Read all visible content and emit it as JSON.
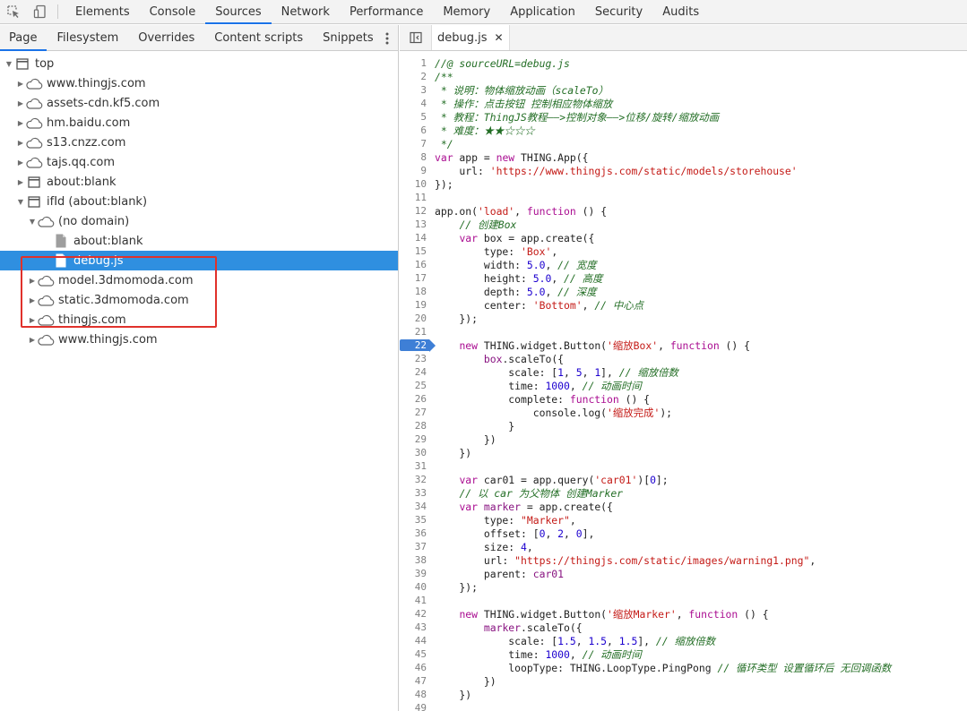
{
  "topbar": {
    "icons": [
      "inspect-element-icon",
      "device-toolbar-icon"
    ],
    "tabs": [
      "Elements",
      "Console",
      "Sources",
      "Network",
      "Performance",
      "Memory",
      "Application",
      "Security",
      "Audits"
    ],
    "active_tab": "Sources"
  },
  "navigator": {
    "tabs": [
      "Page",
      "Filesystem",
      "Overrides",
      "Content scripts",
      "Snippets"
    ],
    "active_tab": "Page",
    "more_icon": "more-vertical-icon",
    "tree": [
      {
        "label": "top",
        "icon": "frame-icon",
        "level": 0,
        "expanded": true
      },
      {
        "label": "www.thingjs.com",
        "icon": "cloud-icon",
        "level": 1,
        "expanded": false
      },
      {
        "label": "assets-cdn.kf5.com",
        "icon": "cloud-icon",
        "level": 1,
        "expanded": false
      },
      {
        "label": "hm.baidu.com",
        "icon": "cloud-icon",
        "level": 1,
        "expanded": false
      },
      {
        "label": "s13.cnzz.com",
        "icon": "cloud-icon",
        "level": 1,
        "expanded": false
      },
      {
        "label": "tajs.qq.com",
        "icon": "cloud-icon",
        "level": 1,
        "expanded": false
      },
      {
        "label": "about:blank",
        "icon": "frame-icon",
        "level": 1,
        "expanded": false
      },
      {
        "label": "ifId (about:blank)",
        "icon": "frame-icon",
        "level": 1,
        "expanded": true
      },
      {
        "label": "(no domain)",
        "icon": "cloud-icon",
        "level": 2,
        "expanded": true
      },
      {
        "label": "about:blank",
        "icon": "file-icon",
        "level": 3,
        "expanded": null
      },
      {
        "label": "debug.js",
        "icon": "file-icon",
        "level": 3,
        "expanded": null,
        "selected": true
      },
      {
        "label": "model.3dmomoda.com",
        "icon": "cloud-icon",
        "level": 2,
        "expanded": false
      },
      {
        "label": "static.3dmomoda.com",
        "icon": "cloud-icon",
        "level": 2,
        "expanded": false
      },
      {
        "label": "thingjs.com",
        "icon": "cloud-icon",
        "level": 2,
        "expanded": false
      },
      {
        "label": "www.thingjs.com",
        "icon": "cloud-icon",
        "level": 2,
        "expanded": false
      }
    ]
  },
  "editor": {
    "sidebar_toggle_icon": "navigator-toggle-icon",
    "file_tab": "debug.js",
    "close_icon": "close-icon",
    "breakpoint_line": 22,
    "lines": [
      {
        "n": "1",
        "html": "<span class=\"c\">//@ sourceURL=debug.js</span>"
      },
      {
        "n": "2",
        "html": "<span class=\"c\">/**</span>"
      },
      {
        "n": "3",
        "html": "<span class=\"c\"> * 说明：物体缩放动画（scaleTo）</span>"
      },
      {
        "n": "4",
        "html": "<span class=\"c\"> * 操作：点击按钮 控制相应物体缩放</span>"
      },
      {
        "n": "5",
        "html": "<span class=\"c\"> * 教程：ThingJS教程——>控制对象——>位移/旋转/缩放动画</span>"
      },
      {
        "n": "6",
        "html": "<span class=\"c\"> * 难度：★★☆☆☆</span>"
      },
      {
        "n": "7",
        "html": "<span class=\"c\"> */</span>"
      },
      {
        "n": "8",
        "html": "<span class=\"k\">var</span> app = <span class=\"k\">new</span> THING.App({"
      },
      {
        "n": "9",
        "html": "    url: <span class=\"s\">'https://www.thingjs.com/static/models/storehouse'</span>"
      },
      {
        "n": "10",
        "html": "});"
      },
      {
        "n": "11",
        "html": ""
      },
      {
        "n": "12",
        "html": "app.on(<span class=\"s\">'load'</span>, <span class=\"k\">function</span> () {"
      },
      {
        "n": "13",
        "html": "    <span class=\"c\">// 创建Box</span>"
      },
      {
        "n": "14",
        "html": "    <span class=\"k\">var</span> box = app.create({"
      },
      {
        "n": "15",
        "html": "        type: <span class=\"s\">'Box'</span>,"
      },
      {
        "n": "16",
        "html": "        width: <span class=\"n\">5.0</span>, <span class=\"c\">// 宽度</span>"
      },
      {
        "n": "17",
        "html": "        height: <span class=\"n\">5.0</span>, <span class=\"c\">// 高度</span>"
      },
      {
        "n": "18",
        "html": "        depth: <span class=\"n\">5.0</span>, <span class=\"c\">// 深度</span>"
      },
      {
        "n": "19",
        "html": "        center: <span class=\"s\">'Bottom'</span>, <span class=\"c\">// 中心点</span>"
      },
      {
        "n": "20",
        "html": "    });"
      },
      {
        "n": "21",
        "html": ""
      },
      {
        "n": "22",
        "html": "    <span class=\"k\">new</span> THING.widget.Button(<span class=\"s\">'缩放Box'</span>, <span class=\"k\">function</span> () {"
      },
      {
        "n": "23",
        "html": "        <span class=\"p\">box</span>.scaleTo({"
      },
      {
        "n": "24",
        "html": "            scale: [<span class=\"n\">1</span>, <span class=\"n\">5</span>, <span class=\"n\">1</span>], <span class=\"c\">// 缩放倍数</span>"
      },
      {
        "n": "25",
        "html": "            time: <span class=\"n\">1000</span>, <span class=\"c\">// 动画时间</span>"
      },
      {
        "n": "26",
        "html": "            complete: <span class=\"k\">function</span> () {"
      },
      {
        "n": "27",
        "html": "                console.log(<span class=\"s\">'缩放完成'</span>);"
      },
      {
        "n": "28",
        "html": "            }"
      },
      {
        "n": "29",
        "html": "        })"
      },
      {
        "n": "30",
        "html": "    })"
      },
      {
        "n": "31",
        "html": ""
      },
      {
        "n": "32",
        "html": "    <span class=\"k\">var</span> car01 = app.query(<span class=\"s\">'car01'</span>)[<span class=\"n\">0</span>];"
      },
      {
        "n": "33",
        "html": "    <span class=\"c\">// 以 car 为父物体 创建Marker</span>"
      },
      {
        "n": "34",
        "html": "    <span class=\"k\">var</span> <span class=\"p\">marker</span> = app.create({"
      },
      {
        "n": "35",
        "html": "        type: <span class=\"s\">\"Marker\"</span>,"
      },
      {
        "n": "36",
        "html": "        offset: [<span class=\"n\">0</span>, <span class=\"n\">2</span>, <span class=\"n\">0</span>],"
      },
      {
        "n": "37",
        "html": "        size: <span class=\"n\">4</span>,"
      },
      {
        "n": "38",
        "html": "        url: <span class=\"s\">\"https://thingjs.com/static/images/warning1.png\"</span>,"
      },
      {
        "n": "39",
        "html": "        parent: <span class=\"p\">car01</span>"
      },
      {
        "n": "40",
        "html": "    });"
      },
      {
        "n": "41",
        "html": ""
      },
      {
        "n": "42",
        "html": "    <span class=\"k\">new</span> THING.widget.Button(<span class=\"s\">'缩放Marker'</span>, <span class=\"k\">function</span> () {"
      },
      {
        "n": "43",
        "html": "        <span class=\"p\">marker</span>.scaleTo({"
      },
      {
        "n": "44",
        "html": "            scale: [<span class=\"n\">1.5</span>, <span class=\"n\">1.5</span>, <span class=\"n\">1.5</span>], <span class=\"c\">// 缩放倍数</span>"
      },
      {
        "n": "45",
        "html": "            time: <span class=\"n\">1000</span>, <span class=\"c\">// 动画时间</span>"
      },
      {
        "n": "46",
        "html": "            loopType: THING.LoopType.PingPong <span class=\"c\">// 循环类型 设置循环后 无回调函数</span>"
      },
      {
        "n": "47",
        "html": "        })"
      },
      {
        "n": "48",
        "html": "    })"
      },
      {
        "n": "49",
        "html": ""
      }
    ]
  },
  "colors": {
    "accent": "#1a73e8",
    "selection": "#2f8fe0",
    "breakpoint": "#3e7fd6",
    "annotation_box": "#e0312b"
  }
}
